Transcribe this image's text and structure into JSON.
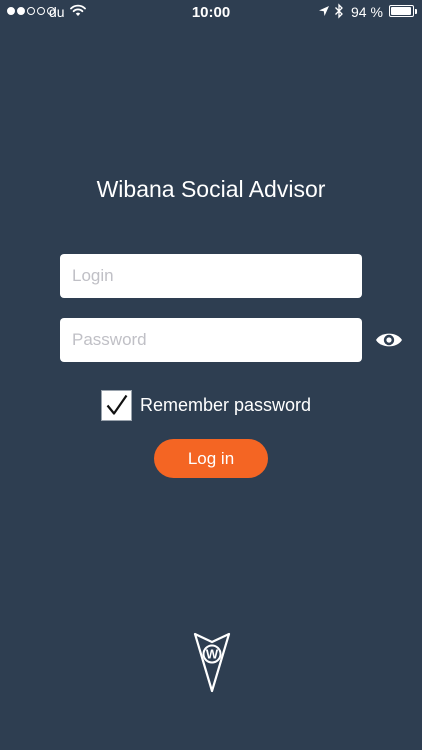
{
  "status_bar": {
    "signal_strength": 2,
    "signal_max": 5,
    "carrier": "du",
    "time": "10:00",
    "battery_percent": "94 %",
    "battery_level": 0.94,
    "icons": [
      "wifi-icon",
      "location-arrow-icon",
      "bluetooth-icon",
      "battery-icon"
    ]
  },
  "app": {
    "title": "Wibana Social Advisor"
  },
  "form": {
    "login_placeholder": "Login",
    "login_value": "",
    "password_placeholder": "Password",
    "password_value": "",
    "remember_label": "Remember password",
    "remember_checked": true,
    "login_button": "Log in"
  },
  "colors": {
    "background": "#2e3e51",
    "accent": "#f46523",
    "text": "#ffffff"
  },
  "logo": {
    "letter": "W"
  }
}
